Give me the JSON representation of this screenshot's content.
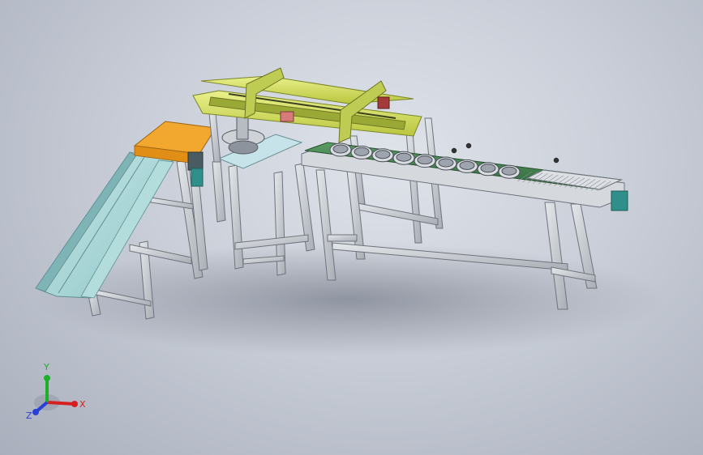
{
  "view": {
    "background_center": "#dfe3ea",
    "background_edge": "#a9afbc"
  },
  "model": {
    "frame_color": "#c8ccd2",
    "frame_edge": "#6e737c",
    "accent_yellow": "#d7e36a",
    "accent_orange": "#f2a72e",
    "belt_green": "#3f7f4c",
    "chute_teal": "#9fd3d3",
    "motor_teal": "#2f8f8a",
    "cup_count": 9
  },
  "triad": {
    "x_label": "X",
    "y_label": "Y",
    "z_label": "Z",
    "x_color": "#d62020",
    "y_color": "#1fae2a",
    "z_color": "#2a3fd6"
  }
}
